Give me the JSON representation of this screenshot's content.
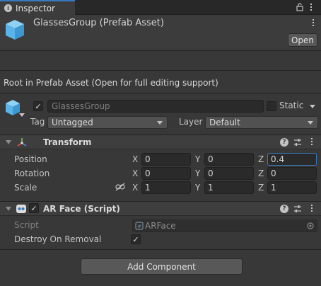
{
  "tab": {
    "label": "Inspector"
  },
  "header": {
    "asset_title": "GlassesGroup (Prefab Asset)",
    "open_label": "Open"
  },
  "root_message": "Root in Prefab Asset (Open for full editing support)",
  "gameobject": {
    "active": true,
    "name": "GlassesGroup",
    "static_label": "Static",
    "static_checked": false,
    "tag_label": "Tag",
    "tag_value": "Untagged",
    "layer_label": "Layer",
    "layer_value": "Default"
  },
  "transform": {
    "title": "Transform",
    "position": {
      "label": "Position",
      "x": "0",
      "y": "0",
      "z": "0.4"
    },
    "rotation": {
      "label": "Rotation",
      "x": "0",
      "y": "0",
      "z": "0"
    },
    "scale": {
      "label": "Scale",
      "x": "1",
      "y": "1",
      "z": "1"
    },
    "axis_x": "X",
    "axis_y": "Y",
    "axis_z": "Z"
  },
  "ar_face": {
    "title": "AR Face (Script)",
    "enabled": true,
    "script_label": "Script",
    "script_value": "ARFace",
    "destroy_label": "Destroy On Removal",
    "destroy_checked": true
  },
  "add_component_label": "Add Component",
  "colors": {
    "accent": "#3a79bb",
    "cube": "#5ab4ea",
    "background": "#383838"
  }
}
